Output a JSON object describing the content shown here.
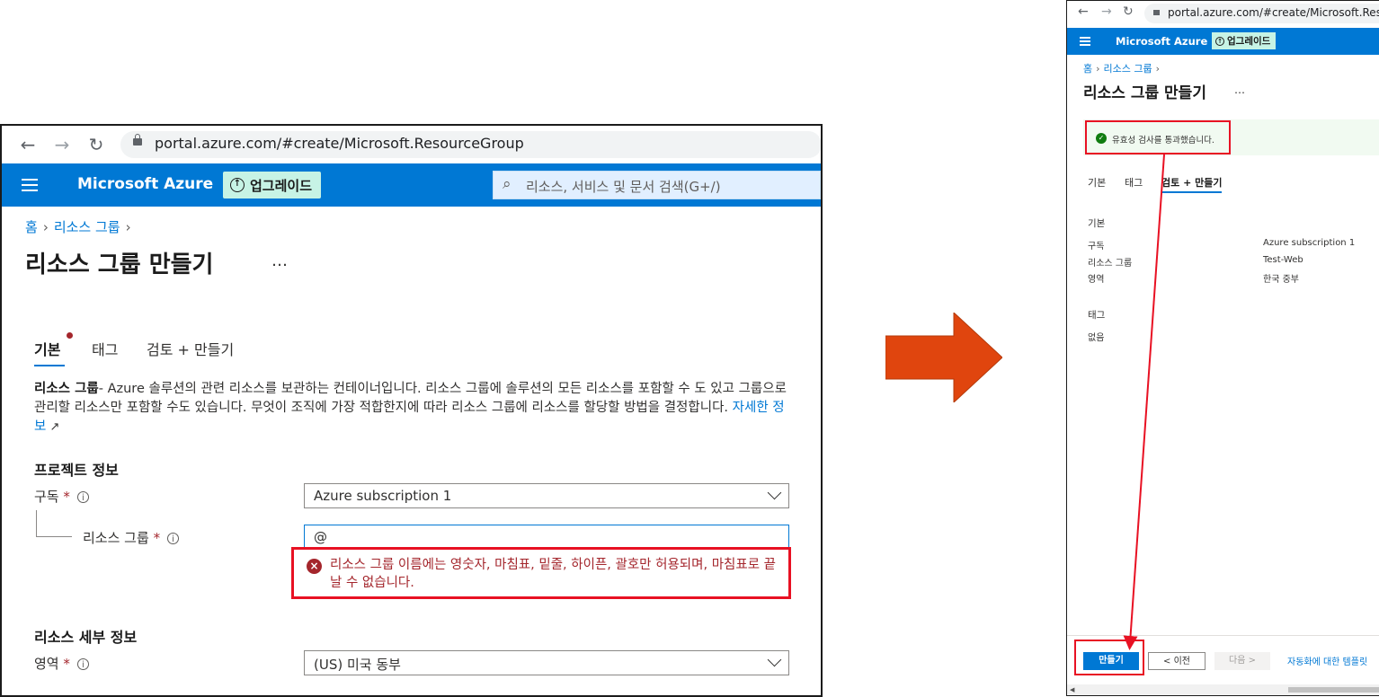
{
  "left": {
    "url": "portal.azure.com/#create/Microsoft.ResourceGroup",
    "brand": "Microsoft Azure",
    "upgrade_label": "업그레이드",
    "search_placeholder": "리소스, 서비스 및 문서 검색(G+/)",
    "breadcrumb": [
      "홈",
      "리소스 그룹"
    ],
    "page_title": "리소스 그룹 만들기",
    "more": "…",
    "tabs": [
      "기본",
      "태그",
      "검토 + 만들기"
    ],
    "description_bold": "리소스 그룹",
    "description": "- Azure 솔루션의 관련 리소스를 보관하는 컨테이너입니다. 리소스 그룹에 솔루션의 모든 리소스를 포함할 수 도 있고 그룹으로 관리할 리소스만 포함할 수도 있습니다. 무엇이 조직에 가장 적합한지에 따라 리소스 그룹에 리소스를 할당할 방법을 결정합니다. ",
    "learn_more": "자세한 정보",
    "project_section": "프로젝트 정보",
    "subscription_label": "구독",
    "subscription_value": "Azure subscription 1",
    "rg_label": "리소스 그룹",
    "rg_value": "@",
    "error_text": "리소스 그룹 이름에는 영숫자, 마침표, 밑줄, 하이픈, 괄호만 허용되며, 마침표로 끝날 수 없습니다.",
    "details_section": "리소스 세부 정보",
    "region_label": "영역",
    "region_value": "(US) 미국 동부",
    "required_mark": "*"
  },
  "right": {
    "url": "portal.azure.com/#create/Microsoft.ResourceG",
    "brand": "Microsoft Azure",
    "upgrade_label": "업그레이드",
    "breadcrumb": [
      "홈",
      "리소스 그룹"
    ],
    "page_title": "리소스 그룹 만들기",
    "more": "…",
    "validation_message": "유효성 검사를 통과했습니다.",
    "tabs": [
      "기본",
      "태그",
      "검토 + 만들기"
    ],
    "basics_section": "기본",
    "rows": [
      {
        "label": "구독",
        "value": "Azure subscription 1"
      },
      {
        "label": "리소스 그룹",
        "value": "Test-Web"
      },
      {
        "label": "영역",
        "value": "한국 중부"
      }
    ],
    "tags_section": "태그",
    "tags_value": "없음",
    "create_button": "만들기",
    "prev_button": "< 이전",
    "next_button": "다음 >",
    "automation_link": "자동화에 대한 템플릿"
  },
  "colors": {
    "azure_blue": "#0078d4",
    "upgrade_green": "#c7f3e5",
    "error_red": "#a4262c",
    "highlight_red": "#e81123",
    "arrow_orange": "#e0450e",
    "success_green": "#107c10"
  }
}
